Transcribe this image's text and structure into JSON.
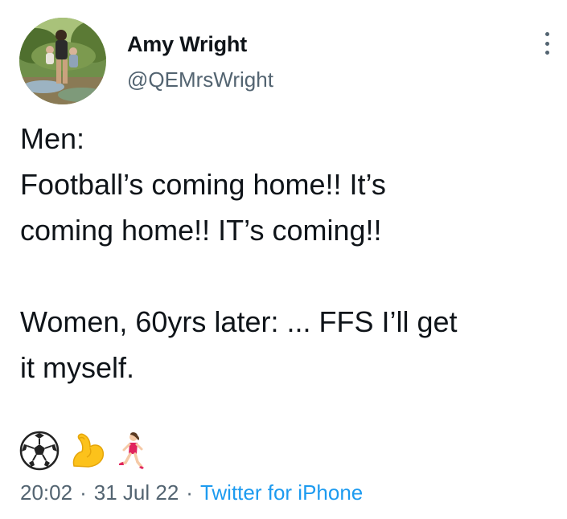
{
  "author": {
    "name": "Amy Wright",
    "handle": "@QEMrsWright"
  },
  "tweet": {
    "text": "Men:\nFootball’s coming home!! It’s\ncoming home!! IT’s coming!!\n\nWomen, 60yrs later: ... FFS I’ll get\nit myself.",
    "emojis": [
      "soccer-ball-icon",
      "flexed-biceps-icon",
      "woman-running-icon"
    ]
  },
  "meta": {
    "time": "20:02",
    "separator": "·",
    "date": "31 Jul 22",
    "source": "Twitter for iPhone"
  },
  "colors": {
    "text": "#0f1419",
    "secondary": "#536471",
    "link": "#1d9bf0"
  }
}
